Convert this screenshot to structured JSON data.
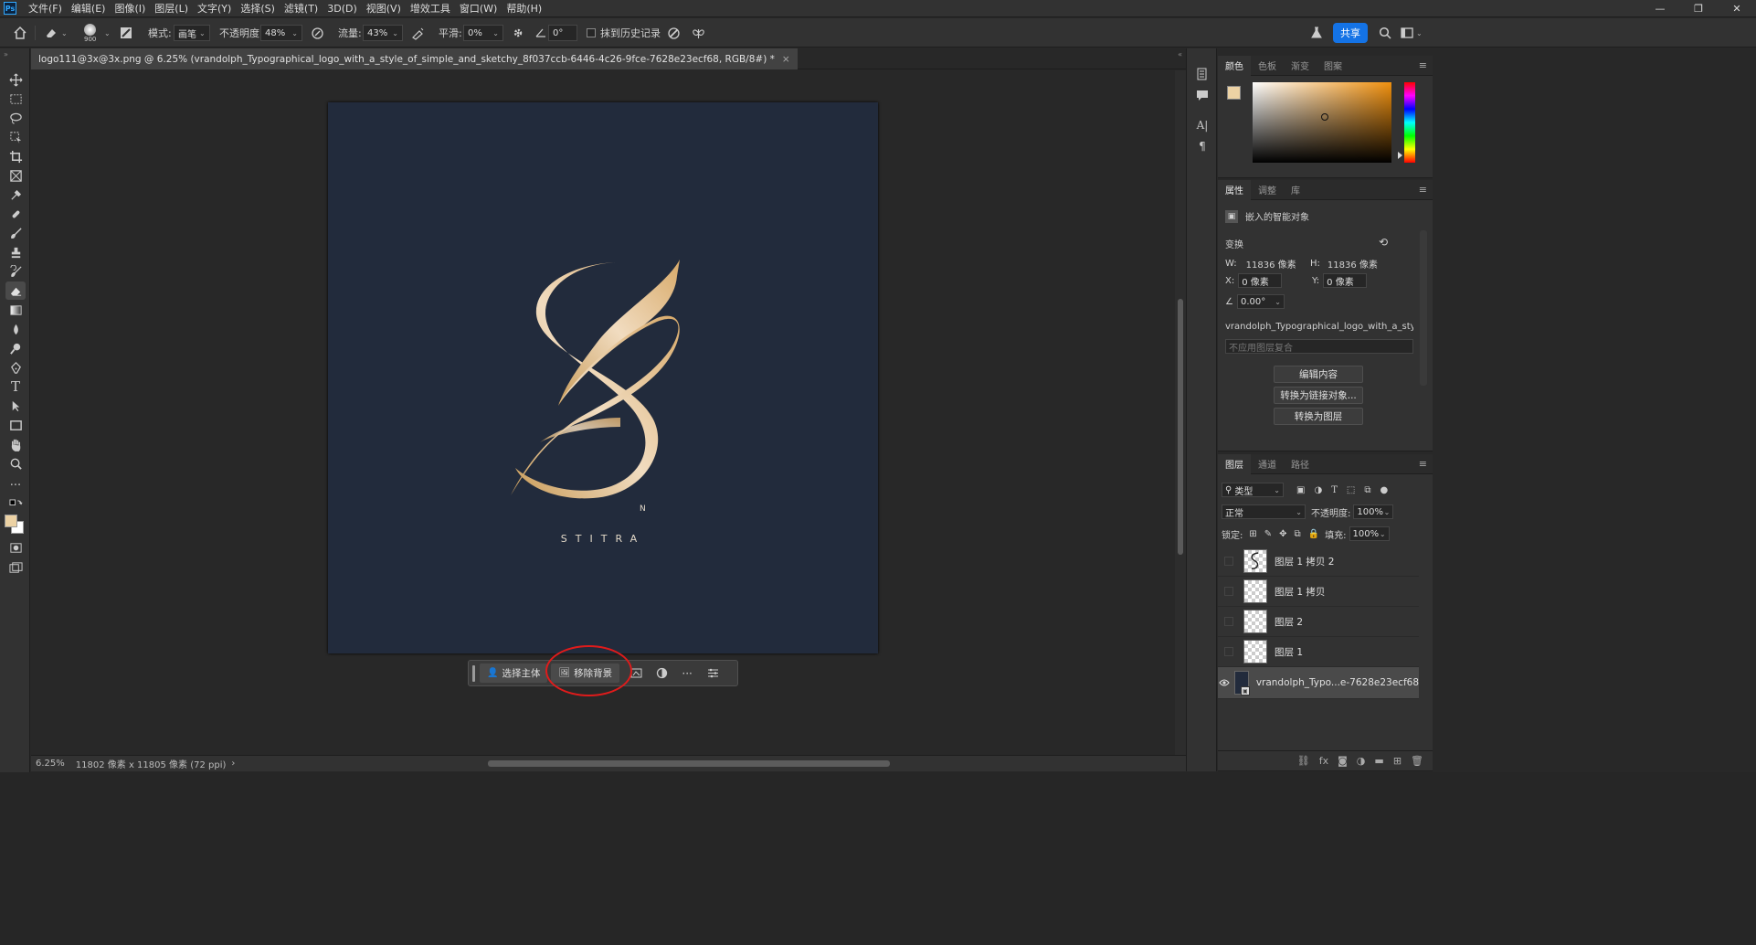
{
  "menubar": {
    "logo": "Ps",
    "items": [
      "文件(F)",
      "编辑(E)",
      "图像(I)",
      "图层(L)",
      "文字(Y)",
      "选择(S)",
      "滤镜(T)",
      "3D(D)",
      "视图(V)",
      "增效工具",
      "窗口(W)",
      "帮助(H)"
    ],
    "win_minimize": "—",
    "win_restore": "❐",
    "win_close": "✕"
  },
  "options": {
    "brush_size": "900",
    "mode_label": "模式:",
    "mode_value": "画笔",
    "opacity_label": "不透明度:",
    "opacity_value": "48%",
    "flow_label": "流量:",
    "flow_value": "43%",
    "smooth_label": "平滑:",
    "smooth_value": "0%",
    "angle_value": "0°",
    "history_label": "抹到历史记录",
    "share_label": "共享"
  },
  "document": {
    "tab_title": "logo111@3x@3x.png @ 6.25% (vrandolph_Typographical_logo_with_a_style_of_simple_and_sketchy_8f037ccb-6446-4c26-9fce-7628e23ecf68, RGB/8#) *",
    "tab_close": "×",
    "brand_text": "STITRA",
    "brand_n": "N"
  },
  "taskbar": {
    "select_subject": "选择主体",
    "remove_background": "移除背景"
  },
  "status": {
    "zoom": "6.25%",
    "doc_info": "11802 像素 x 11805 像素 (72 ppi)",
    "arrow": "›"
  },
  "color_panel": {
    "tabs": [
      "颜色",
      "色板",
      "渐变",
      "图案"
    ],
    "fg_color": "#ecd2a4",
    "bg_color": "#ffffff"
  },
  "props_panel": {
    "tabs": [
      "属性",
      "调整",
      "库"
    ],
    "type_label": "嵌入的智能对象",
    "transform_label": "变换",
    "w_label": "W:",
    "w_value": "11836 像素",
    "h_label": "H:",
    "h_value": "11836 像素",
    "x_label": "X:",
    "x_value": "0 像素",
    "y_label": "Y:",
    "y_value": "0 像素",
    "angle_value": "0.00°",
    "source_name": "vrandolph_Typographical_logo_with_a_style_of...",
    "comp_placeholder": "不应用图层复合",
    "btn_edit": "编辑内容",
    "btn_linked": "转换为链接对象...",
    "btn_layers": "转换为图层"
  },
  "layers_panel": {
    "tabs": [
      "图层",
      "通道",
      "路径"
    ],
    "filter_label": "类型",
    "blend_mode": "正常",
    "opacity_label": "不透明度:",
    "opacity_value": "100%",
    "lock_label": "锁定:",
    "fill_label": "填充:",
    "fill_value": "100%",
    "layers": [
      {
        "name": "图层 1 拷贝 2",
        "visible": false
      },
      {
        "name": "图层 1 拷贝",
        "visible": false
      },
      {
        "name": "图层 2",
        "visible": false
      },
      {
        "name": "图层 1",
        "visible": false
      },
      {
        "name": "vrandolph_Typo...e-7628e23ecf68",
        "visible": true
      }
    ]
  }
}
